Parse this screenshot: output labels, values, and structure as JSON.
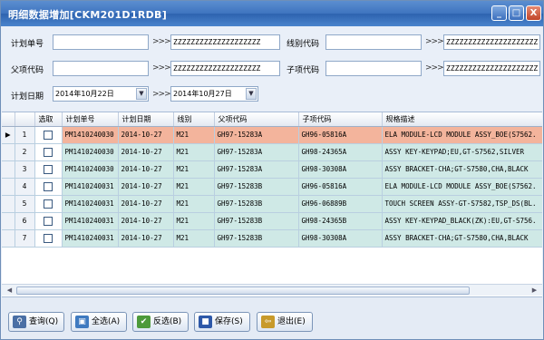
{
  "window": {
    "title": "明细数据增加[CKM201D1RDB]"
  },
  "titlebar_buttons": {
    "minimize": "_",
    "maximize": "□",
    "close": "X"
  },
  "form": {
    "plan_no_label": "计划单号",
    "plan_no_value": "",
    "plan_no_to_value": "ZZZZZZZZZZZZZZZZZZZZ",
    "line_code_label": "线别代码",
    "line_code_value": "",
    "line_code_to_value": "ZZZZZZZZZZZZZZZZZZZZZ",
    "parent_code_label": "父项代码",
    "parent_code_value": "",
    "parent_code_to_value": "ZZZZZZZZZZZZZZZZZZZZ",
    "child_code_label": "子项代码",
    "child_code_value": "",
    "child_code_to_value": "ZZZZZZZZZZZZZZZZZZZZZ",
    "plan_date_label": "计划日期",
    "plan_date_from": "2014年10月22日",
    "plan_date_to": "2014年10月27日",
    "range_arrow": ">>>"
  },
  "grid": {
    "columns": [
      "",
      "",
      "选取",
      "计划单号",
      "计划日期",
      "线别",
      "父项代码",
      "子项代码",
      "规格描述"
    ],
    "rows": [
      {
        "marker": "▶",
        "num": "1",
        "plan_no": "PM1410240030",
        "date": "2014-10-27",
        "line": "M21",
        "parent": "GH97-15283A",
        "child": "GH96-05816A",
        "desc": "ELA MODULE-LCD MODULE ASSY_BOE(S7562."
      },
      {
        "marker": "",
        "num": "2",
        "plan_no": "PM1410240030",
        "date": "2014-10-27",
        "line": "M21",
        "parent": "GH97-15283A",
        "child": "GH98-24365A",
        "desc": "ASSY KEY-KEYPAD;EU,GT-S7562,SILVER"
      },
      {
        "marker": "",
        "num": "3",
        "plan_no": "PM1410240030",
        "date": "2014-10-27",
        "line": "M21",
        "parent": "GH97-15283A",
        "child": "GH98-30308A",
        "desc": "ASSY BRACKET-CHA;GT-S7580,CHA,BLACK"
      },
      {
        "marker": "",
        "num": "4",
        "plan_no": "PM1410240031",
        "date": "2014-10-27",
        "line": "M21",
        "parent": "GH97-15283B",
        "child": "GH96-05816A",
        "desc": "ELA MODULE-LCD MODULE ASSY_BOE(S7562."
      },
      {
        "marker": "",
        "num": "5",
        "plan_no": "PM1410240031",
        "date": "2014-10-27",
        "line": "M21",
        "parent": "GH97-15283B",
        "child": "GH96-06889B",
        "desc": "TOUCH SCREEN ASSY-GT-S7582,TSP_DS(BL."
      },
      {
        "marker": "",
        "num": "6",
        "plan_no": "PM1410240031",
        "date": "2014-10-27",
        "line": "M21",
        "parent": "GH97-15283B",
        "child": "GH98-24365B",
        "desc": "ASSY KEY-KEYPAD_BLACK(ZK):EU,GT-S756."
      },
      {
        "marker": "",
        "num": "7",
        "plan_no": "PM1410240031",
        "date": "2014-10-27",
        "line": "M21",
        "parent": "GH97-15283B",
        "child": "GH98-30308A",
        "desc": "ASSY BRACKET-CHA;GT-S7580,CHA,BLACK"
      }
    ]
  },
  "buttons": {
    "query": "查询(Q)",
    "select_all": "全选(A)",
    "invert": "反选(B)",
    "save": "保存(S)",
    "exit": "退出(E)"
  },
  "colors": {
    "selected_row": "#f3b49c",
    "row": "#cfe9e6",
    "titlebar": "#3e74bf"
  }
}
